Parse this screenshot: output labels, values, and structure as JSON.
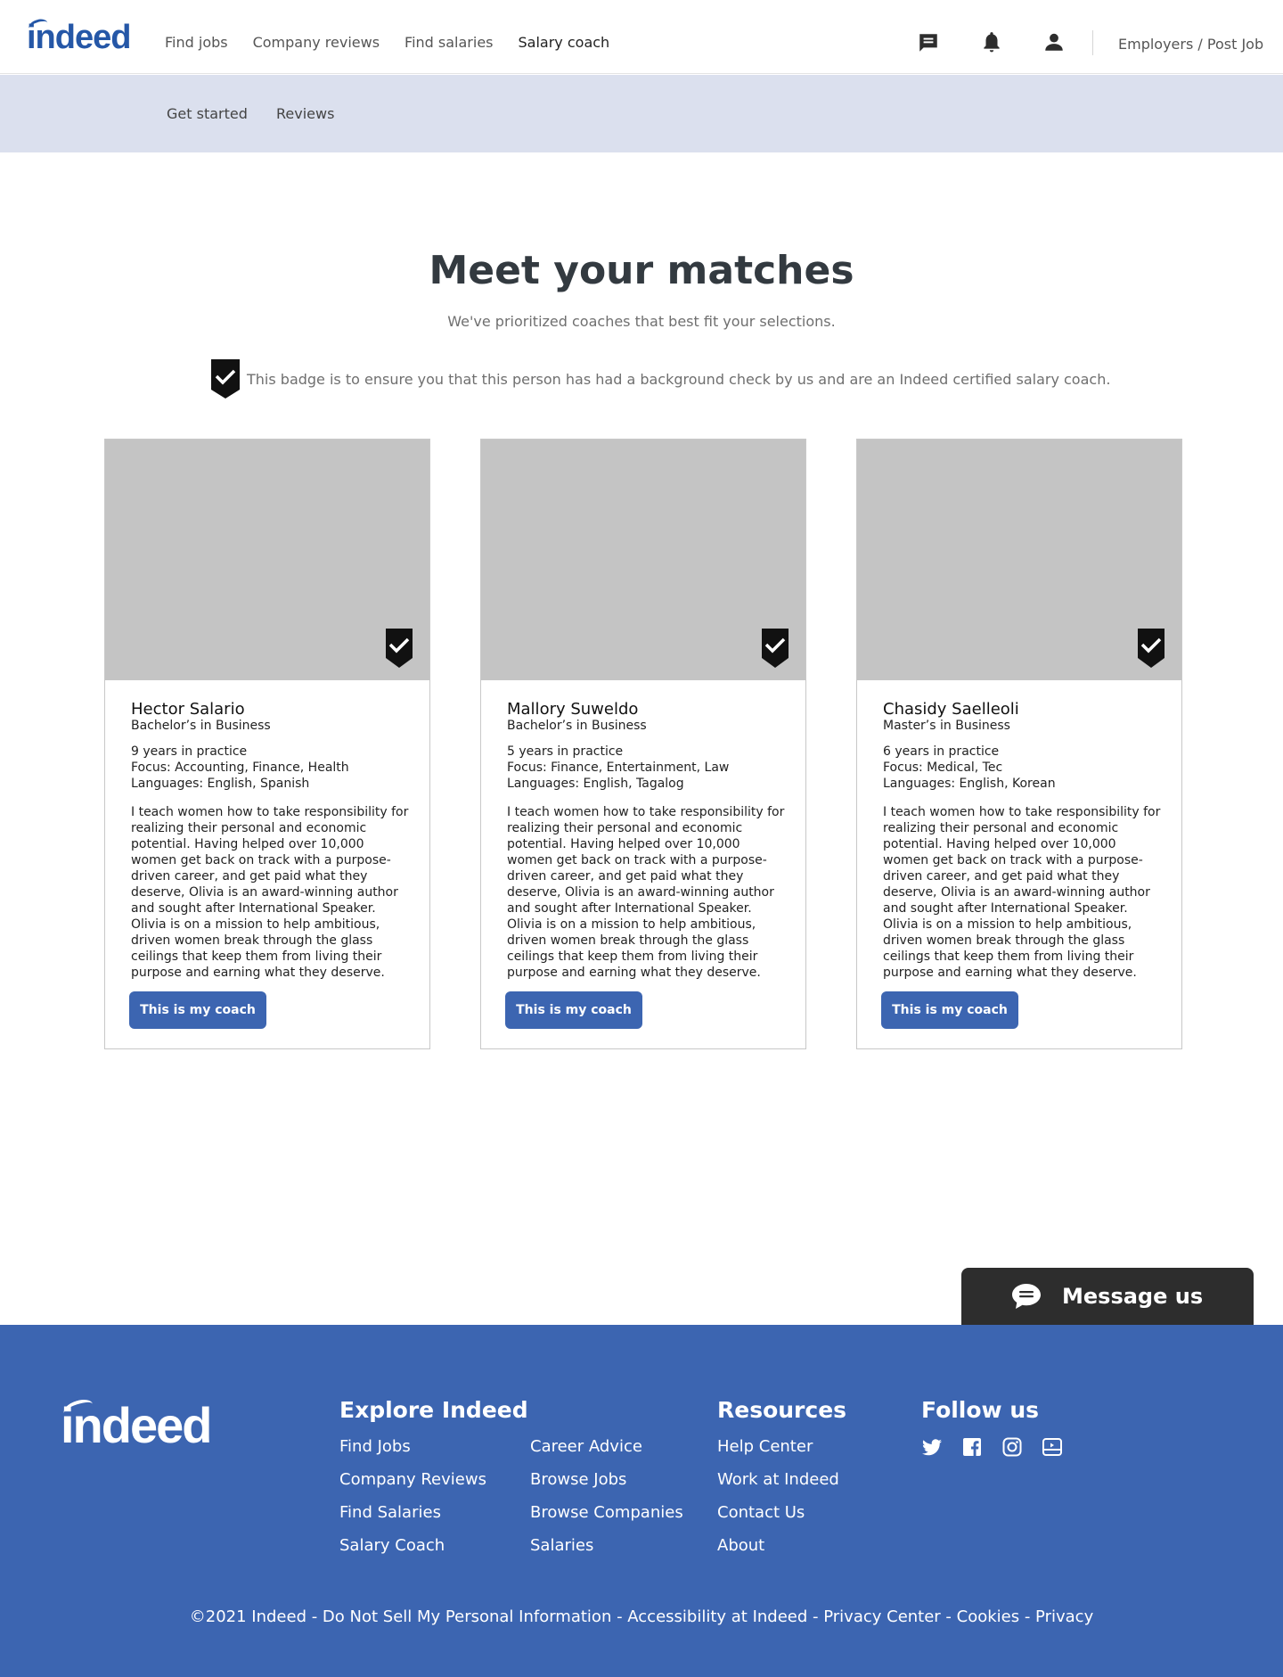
{
  "header": {
    "logo_text": "indeed",
    "nav": [
      "Find jobs",
      "Company reviews",
      "Find salaries",
      "Salary coach"
    ],
    "employers_link": "Employers / Post Job",
    "icons": [
      "chat-icon",
      "bell-icon",
      "person-icon"
    ]
  },
  "subnav": {
    "items": [
      "Get started",
      "Reviews"
    ]
  },
  "hero": {
    "title": "Meet your matches",
    "subtitle": "We've prioritized coaches that best fit your selections.",
    "badge_note": "This badge is to ensure you that this person has had a background check by us and are an Indeed certified salary coach."
  },
  "coaches": [
    {
      "name": "Hector Salario",
      "degree": "Bachelor’s in Business",
      "years": "9 years in practice",
      "focus": "Focus: Accounting, Finance, Health",
      "languages": "Languages: English, Spanish",
      "bio": "I teach women how to take responsibility for realizing their personal and economic potential. Having helped over 10,000 women get back on track with a purpose-driven career, and get paid what they deserve, Olivia is an award-winning author and sought after International Speaker. Olivia is on a mission to help ambitious, driven women break through the glass ceilings that keep them from living their purpose and earning what they deserve.",
      "button": "This is my coach"
    },
    {
      "name": "Mallory Suweldo",
      "degree": "Bachelor’s in Business",
      "years": "5 years in practice",
      "focus": "Focus: Finance, Entertainment, Law",
      "languages": "Languages: English, Tagalog",
      "bio": "I teach women how to take responsibility for realizing their personal and economic potential. Having helped over 10,000 women get back on track with a purpose-driven career, and get paid what they deserve, Olivia is an award-winning author and sought after International Speaker. Olivia is on a mission to help ambitious, driven women break through the glass ceilings that keep them from living their purpose and earning what they deserve.",
      "button": "This is my coach"
    },
    {
      "name": "Chasidy Saelleoli",
      "degree": "Master’s in Business",
      "years": "6 years in practice",
      "focus": "Focus: Medical, Tec",
      "languages": "Languages: English, Korean",
      "bio": "I teach women how to take responsibility for realizing their personal and economic potential. Having helped over 10,000 women get back on track with a purpose-driven career, and get paid what they deserve, Olivia is an award-winning author and sought after International Speaker. Olivia is on a mission to help ambitious, driven women break through the glass ceilings that keep them from living their purpose and earning what they deserve.",
      "button": "This is my coach"
    }
  ],
  "message_us": {
    "label": "Message us"
  },
  "footer": {
    "logo_text": "indeed",
    "explore": {
      "title": "Explore Indeed",
      "col1": [
        "Find Jobs",
        "Company Reviews",
        "Find Salaries",
        "Salary Coach"
      ],
      "col2": [
        "Career Advice",
        "Browse Jobs",
        "Browse Companies",
        "Salaries"
      ]
    },
    "resources": {
      "title": "Resources",
      "links": [
        "Help Center",
        "Work at Indeed",
        "Contact Us",
        "About"
      ]
    },
    "follow": {
      "title": "Follow us",
      "icons": [
        "twitter-icon",
        "facebook-icon",
        "instagram-icon",
        "youtube-icon"
      ]
    },
    "copyright": "©2021 Indeed - Do Not Sell My Personal Information - Accessibility at Indeed - Privacy Center - Cookies - Privacy"
  },
  "colors": {
    "brand_blue": "#2557a7",
    "footer_blue": "#3c65b1",
    "subnav_bg": "#dbe0ee",
    "button_blue": "#3c65b1",
    "photo_placeholder": "#c4c4c4"
  }
}
